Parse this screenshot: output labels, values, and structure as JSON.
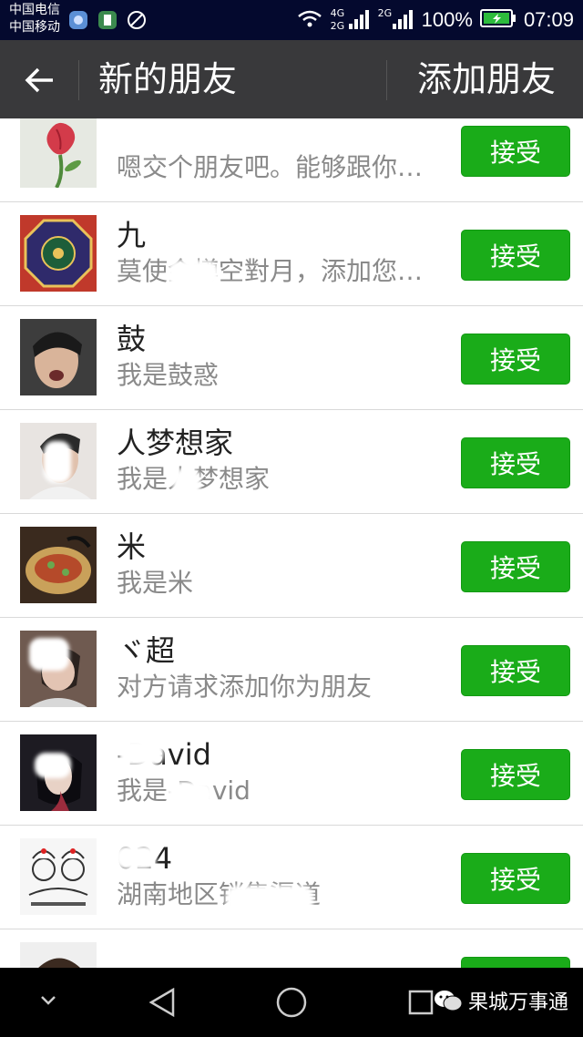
{
  "status_bar": {
    "carrier_1": "中国电信",
    "carrier_2": "中国移动",
    "network_1": "4G",
    "network_2": "2G",
    "network_3": "2G",
    "battery": "100%",
    "time": "07:09"
  },
  "header": {
    "title": "新的朋友",
    "add_friend": "添加朋友"
  },
  "requests": [
    {
      "name": "",
      "message": "嗯交个朋友吧。能够跟你一起"
    },
    {
      "name": "九",
      "message": "莫使金樽空對月，添加您为好友"
    },
    {
      "name": "鼓",
      "message": "我是鼓惑"
    },
    {
      "name": "人梦想家",
      "message": "我是人梦想家"
    },
    {
      "name": "米",
      "message": "我是米"
    },
    {
      "name": "ヾ超",
      "message": "对方请求添加你为朋友"
    },
    {
      "name": "-David",
      "message": "我是-David"
    },
    {
      "name": "024",
      "message": "湖南地区销售渠道"
    },
    {
      "name": "",
      "message": ""
    }
  ],
  "accept_label": "接受",
  "watermark": "果城万事通",
  "accent_color": "#1aac19"
}
